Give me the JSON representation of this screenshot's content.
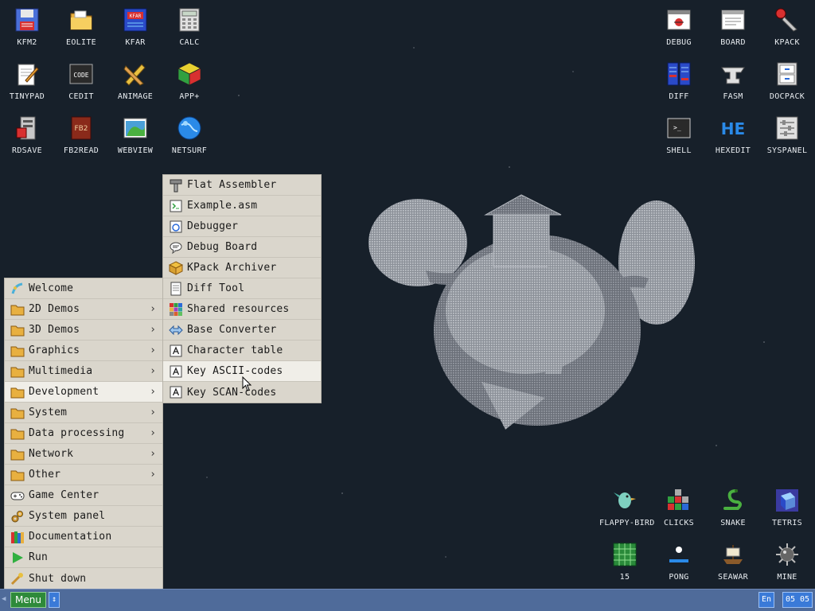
{
  "desktop_icons": {
    "kfm2": "KFM2",
    "eolite": "EOLITE",
    "kfar": "KFAR",
    "calc": "CALC",
    "tinypad": "TINYPAD",
    "cedit": "CEDIT",
    "animage": "ANIMAGE",
    "app_plus": "APP+",
    "rdsave": "RDSAVE",
    "fb2read": "FB2READ",
    "webview": "WEBVIEW",
    "netsurf": "NETSURF",
    "debug": "DEBUG",
    "board": "BOARD",
    "kpack": "KPACK",
    "diff": "DIFF",
    "fasm": "FASM",
    "docpack": "DOCPACK",
    "shell": "SHELL",
    "hexedit": "HEXEDIT",
    "syspanel": "SYSPANEL",
    "flappy_bird": "FLAPPY-BIRD",
    "clicks": "CLICKS",
    "snake": "SNAKE",
    "tetris": "TETRIS",
    "n15": "15",
    "pong": "PONG",
    "seawar": "SEAWAR",
    "mine": "MINE"
  },
  "icon_glyphs": {
    "cedit": "CODE",
    "hexedit": "HE",
    "fb2read": "FB2",
    "kfar": "KFAR",
    "shell_prompt": ">_"
  },
  "main_menu": [
    {
      "label": "Welcome",
      "icon": "welcome-icon"
    },
    {
      "label": "2D Demos",
      "icon": "folder-icon",
      "submenu": true
    },
    {
      "label": "3D Demos",
      "icon": "folder-icon",
      "submenu": true
    },
    {
      "label": "Graphics",
      "icon": "folder-icon",
      "submenu": true
    },
    {
      "label": "Multimedia",
      "icon": "folder-icon",
      "submenu": true
    },
    {
      "label": "Development",
      "icon": "folder-icon",
      "submenu": true,
      "active": true
    },
    {
      "label": "System",
      "icon": "folder-icon",
      "submenu": true
    },
    {
      "label": "Data processing",
      "icon": "folder-icon",
      "submenu": true
    },
    {
      "label": "Network",
      "icon": "folder-icon",
      "submenu": true
    },
    {
      "label": "Other",
      "icon": "folder-icon",
      "submenu": true
    },
    {
      "label": "Game Center",
      "icon": "gamepad-icon"
    },
    {
      "label": "System panel",
      "icon": "gears-icon"
    },
    {
      "label": "Documentation",
      "icon": "books-icon"
    },
    {
      "label": "Run",
      "icon": "play-icon"
    },
    {
      "label": "Shut down",
      "icon": "power-icon"
    }
  ],
  "submenu_arrow": "›",
  "dev_submenu": [
    {
      "label": "Flat Assembler",
      "icon": "hammer-icon"
    },
    {
      "label": "Example.asm",
      "icon": "asm-file-icon"
    },
    {
      "label": "Debugger",
      "icon": "debugger-icon"
    },
    {
      "label": "Debug Board",
      "icon": "chat-board-icon"
    },
    {
      "label": "KPack Archiver",
      "icon": "archive-box-icon"
    },
    {
      "label": "Diff Tool",
      "icon": "document-icon"
    },
    {
      "label": "Shared resources",
      "icon": "grid-icon"
    },
    {
      "label": "Base Converter",
      "icon": "arrows-icon"
    },
    {
      "label": "Character table",
      "icon": "letter-a-icon"
    },
    {
      "label": "Key ASCII-codes",
      "icon": "letter-a-icon",
      "active": true
    },
    {
      "label": "Key SCAN-codes",
      "icon": "letter-a-icon"
    }
  ],
  "taskbar": {
    "menu_label": "Menu",
    "left_arrow": "◀",
    "switch_glyph": "↕",
    "language": "En",
    "clock": "05 05"
  },
  "colors": {
    "desktop_bg": "#17202a",
    "menu_bg": "#dad6cc",
    "menu_active": "#f0eee8",
    "taskbar_bg": "#4f6b9a",
    "menu_button": "#2e8a3a",
    "tray_blue": "#3a7ad8"
  }
}
